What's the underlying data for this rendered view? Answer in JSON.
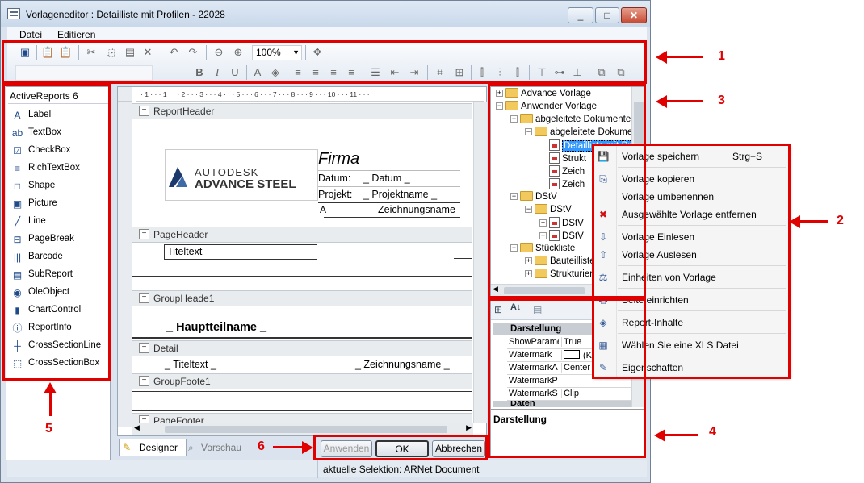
{
  "window": {
    "title": "Vorlageneditor : Detailliste mit Profilen - 22028",
    "min": "_",
    "max": "□",
    "close": "✕"
  },
  "menu": [
    {
      "label": "Datei"
    },
    {
      "label": "Editieren"
    }
  ],
  "toolbar": {
    "zoom": "100%"
  },
  "toolbox": {
    "title": "ActiveReports 6",
    "items": [
      {
        "label": "Label",
        "icon": "label-icon",
        "glyph": "A"
      },
      {
        "label": "TextBox",
        "icon": "textbox-icon",
        "glyph": "ab"
      },
      {
        "label": "CheckBox",
        "icon": "checkbox-icon",
        "glyph": "☑"
      },
      {
        "label": "RichTextBox",
        "icon": "richtextbox-icon",
        "glyph": "≡"
      },
      {
        "label": "Shape",
        "icon": "shape-icon",
        "glyph": "□"
      },
      {
        "label": "Picture",
        "icon": "picture-icon",
        "glyph": "▣"
      },
      {
        "label": "Line",
        "icon": "line-icon",
        "glyph": "╱"
      },
      {
        "label": "PageBreak",
        "icon": "pagebreak-icon",
        "glyph": "⊟"
      },
      {
        "label": "Barcode",
        "icon": "barcode-icon",
        "glyph": "|||"
      },
      {
        "label": "SubReport",
        "icon": "subreport-icon",
        "glyph": "▤"
      },
      {
        "label": "OleObject",
        "icon": "oleobject-icon",
        "glyph": "◉"
      },
      {
        "label": "ChartControl",
        "icon": "chart-icon",
        "glyph": "▮"
      },
      {
        "label": "ReportInfo",
        "icon": "reportinfo-icon",
        "glyph": "ⓘ"
      },
      {
        "label": "CrossSectionLine",
        "icon": "crosssectionline-icon",
        "glyph": "┼"
      },
      {
        "label": "CrossSectionBox",
        "icon": "crosssectionbox-icon",
        "glyph": "⬚"
      }
    ]
  },
  "designer": {
    "ruler": "· 1 · · · 1 · · · 2 · · · 3 · · · 4 · · · 5 · · · 6 · · · 7 · · · 8 · · · 9 · · · 10 · · · 11 · · ·",
    "bands": {
      "report_header": "ReportHeader",
      "page_header": "PageHeader",
      "group_header": "GroupHeade1",
      "detail": "Detail",
      "group_footer": "GroupFoote1",
      "page_footer": "PageFooter"
    },
    "logo_line1": "AUTODESK",
    "logo_line2": "ADVANCE STEEL",
    "firma": "Firma",
    "datum_label": "Datum:",
    "datum_value": "_ Datum _",
    "projekt_label": "Projekt:",
    "projekt_value": "_ Projektname _",
    "a_label": "A",
    "zeichnungsname": "Zeichnungsname",
    "titeltext": "Titeltext",
    "hauptteilname": "_ Hauptteilname _",
    "detail_titeltext": "_ Titeltext _",
    "detail_zeichnungsname": "_ Zeichnungsname _",
    "tab_designer": "Designer",
    "tab_vorschau": "Vorschau"
  },
  "buttons": {
    "apply": "Anwenden",
    "ok": "OK",
    "cancel": "Abbrechen"
  },
  "status": "aktuelle Selektion: ARNet Document",
  "tree": [
    {
      "label": "Advance Vorlage",
      "indent": 0,
      "pm": "+",
      "type": "folder"
    },
    {
      "label": "Anwender Vorlage",
      "indent": 0,
      "pm": "−",
      "type": "folder"
    },
    {
      "label": "abgeleitete Dokumente",
      "indent": 1,
      "pm": "−",
      "type": "folder"
    },
    {
      "label": "abgeleitete Dokume",
      "indent": 2,
      "pm": "−",
      "type": "folder"
    },
    {
      "label": "Detailliste mit Pr",
      "indent": 3,
      "pm": "",
      "type": "doc",
      "selected": true
    },
    {
      "label": "Strukt",
      "indent": 3,
      "pm": "",
      "type": "doc"
    },
    {
      "label": "Zeich",
      "indent": 3,
      "pm": "",
      "type": "doc"
    },
    {
      "label": "Zeich",
      "indent": 3,
      "pm": "",
      "type": "doc"
    },
    {
      "label": "DStV",
      "indent": 1,
      "pm": "−",
      "type": "folder"
    },
    {
      "label": "DStV",
      "indent": 2,
      "pm": "−",
      "type": "folder"
    },
    {
      "label": "DStV",
      "indent": 3,
      "pm": "+",
      "type": "doc"
    },
    {
      "label": "DStV",
      "indent": 3,
      "pm": "+",
      "type": "doc"
    },
    {
      "label": "Stückliste",
      "indent": 1,
      "pm": "−",
      "type": "folder"
    },
    {
      "label": "Bauteilliste",
      "indent": 2,
      "pm": "+",
      "type": "folder"
    },
    {
      "label": "Strukturier",
      "indent": 2,
      "pm": "+",
      "type": "folder"
    }
  ],
  "props": {
    "category": "Darstellung",
    "rows": [
      {
        "key": "ShowParame",
        "value": "True"
      },
      {
        "key": "Watermark",
        "value": "(K"
      },
      {
        "key": "WatermarkA",
        "value": "Center"
      },
      {
        "key": "WatermarkP",
        "value": ""
      },
      {
        "key": "WatermarkS",
        "value": "Clip"
      }
    ],
    "next_category": "Daten",
    "desc_title": "Darstellung"
  },
  "context_menu": [
    {
      "label": "Vorlage speichern",
      "shortcut": "Strg+S",
      "icon": "save-icon",
      "glyph": "💾",
      "sep_after": true
    },
    {
      "label": "Vorlage kopieren",
      "shortcut": "",
      "icon": "copy-icon",
      "glyph": "⎘",
      "sep_after": false
    },
    {
      "label": "Vorlage umbenennen",
      "shortcut": "",
      "icon": "",
      "glyph": "",
      "sep_after": false
    },
    {
      "label": "Ausgewählte Vorlage entfernen",
      "shortcut": "",
      "icon": "delete-icon",
      "glyph": "✖",
      "sep_after": true
    },
    {
      "label": "Vorlage Einlesen",
      "shortcut": "",
      "icon": "import-icon",
      "glyph": "⇩",
      "sep_after": false
    },
    {
      "label": "Vorlage Auslesen",
      "shortcut": "",
      "icon": "export-icon",
      "glyph": "⇧",
      "sep_after": true
    },
    {
      "label": "Einheiten von Vorlage",
      "shortcut": "",
      "icon": "units-icon",
      "glyph": "⚖",
      "sep_after": true
    },
    {
      "label": "Seite einrichten",
      "shortcut": "",
      "icon": "page-setup-icon",
      "glyph": "🖶",
      "sep_after": true
    },
    {
      "label": "Report-Inhalte",
      "shortcut": "",
      "icon": "report-contents-icon",
      "glyph": "◈",
      "sep_after": true
    },
    {
      "label": "Wählen Sie eine XLS Datei",
      "shortcut": "",
      "icon": "xls-icon",
      "glyph": "▦",
      "sep_after": true
    },
    {
      "label": "Eigenschaften",
      "shortcut": "",
      "icon": "properties-icon",
      "glyph": "✎",
      "sep_after": false
    }
  ],
  "annotations": [
    "1",
    "2",
    "3",
    "4",
    "5",
    "6"
  ],
  "colors": {
    "annotation": "#e00000",
    "selection": "#3399ff"
  }
}
